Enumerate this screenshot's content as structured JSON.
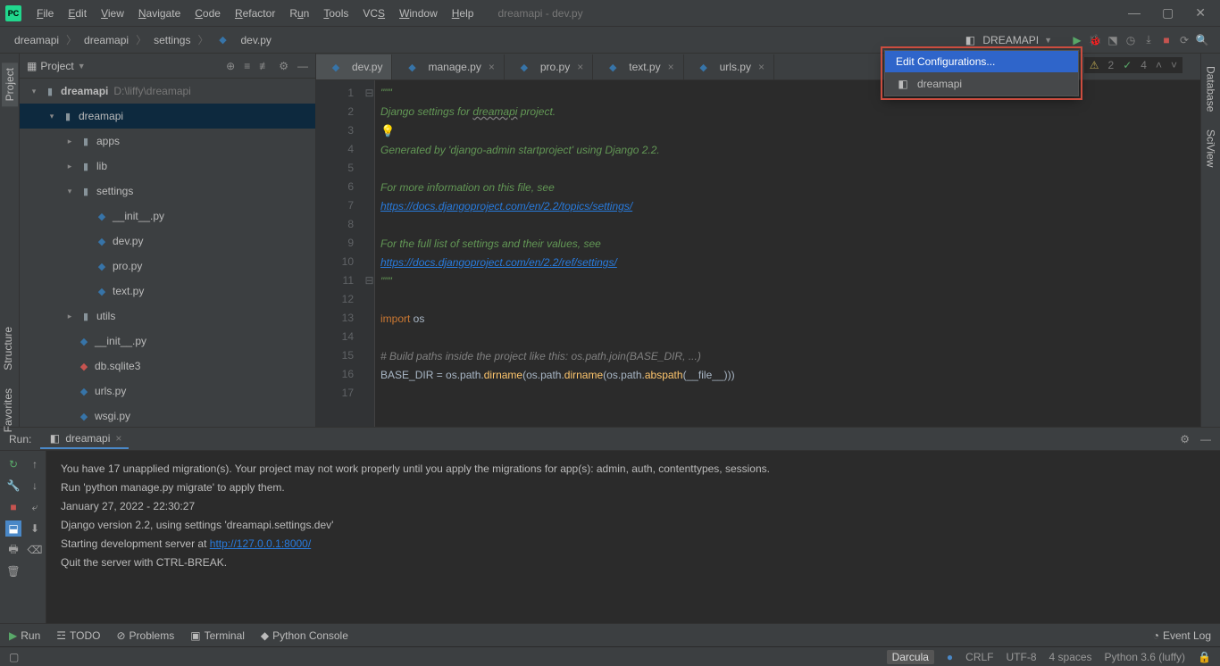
{
  "title": "dreamapi - dev.py",
  "menu": [
    "File",
    "Edit",
    "View",
    "Navigate",
    "Code",
    "Refactor",
    "Run",
    "Tools",
    "VCS",
    "Window",
    "Help"
  ],
  "breadcrumbs": [
    "dreamapi",
    "dreamapi",
    "settings",
    "dev.py"
  ],
  "run_config": "DREAMAPI",
  "dropdown": {
    "edit": "Edit Configurations...",
    "item": "dreamapi"
  },
  "project_header": "Project",
  "tree": {
    "root": "dreamapi",
    "root_path": "D:\\liffy\\dreamapi",
    "dreamapi": "dreamapi",
    "apps": "apps",
    "lib": "lib",
    "settings": "settings",
    "init": "__init__.py",
    "dev": "dev.py",
    "pro": "pro.py",
    "text": "text.py",
    "utils": "utils",
    "init2": "__init__.py",
    "db": "db.sqlite3",
    "urls": "urls.py",
    "wsgi": "wsgi.py"
  },
  "tabs": [
    "dev.py",
    "manage.py",
    "pro.py",
    "text.py",
    "urls.py"
  ],
  "indicators": {
    "warn": "2",
    "ok": "4"
  },
  "code": {
    "l1": "\"\"\"",
    "l2a": "Django settings for ",
    "l2b": "dreamapi",
    "l2c": " project.",
    "l4": "Generated by 'django-admin startproject' using Django 2.2.",
    "l6": "For more information on this file, see",
    "l7": "https://docs.djangoproject.com/en/2.2/topics/settings/",
    "l9": "For the full list of settings and their values, see",
    "l10": "https://docs.djangoproject.com/en/2.2/ref/settings/",
    "l11": "\"\"\"",
    "l13a": "import",
    "l13b": " os",
    "l15": "# Build paths inside the project like this: os.path.join(BASE_DIR, ...)",
    "l16a": "BASE_DIR = os.path.",
    "l16b": "dirname",
    "l16c": "(os.path.",
    "l16d": "dirname",
    "l16e": "(os.path.",
    "l16f": "abspath",
    "l16g": "(",
    "l16h": "__file__",
    "l16i": ")))"
  },
  "gutter_lines": [
    "1",
    "2",
    "3",
    "4",
    "5",
    "6",
    "7",
    "8",
    "9",
    "10",
    "11",
    "12",
    "13",
    "14",
    "15",
    "16",
    "17"
  ],
  "run": {
    "label": "Run:",
    "tab": "dreamapi",
    "out1": "You have 17 unapplied migration(s). Your project may not work properly until you apply the migrations for app(s): admin, auth, contenttypes, sessions.",
    "out2": "Run 'python manage.py migrate' to apply them.",
    "out3": "January 27, 2022 - 22:30:27",
    "out4": "Django version 2.2, using settings 'dreamapi.settings.dev'",
    "out5a": "Starting development server at ",
    "out5b": "http://127.0.0.1:8000/",
    "out6": "Quit the server with CTRL-BREAK."
  },
  "bottom": {
    "run": "Run",
    "todo": "TODO",
    "problems": "Problems",
    "terminal": "Terminal",
    "pyconsole": "Python Console",
    "eventlog": "Event Log"
  },
  "status": {
    "theme": "Darcula",
    "eol": "CRLF",
    "enc": "UTF-8",
    "indent": "4 spaces",
    "py": "Python 3.6 (luffy)"
  },
  "sidetabs": {
    "project": "Project",
    "structure": "Structure",
    "favorites": "Favorites",
    "database": "Database",
    "sciview": "SciView"
  }
}
